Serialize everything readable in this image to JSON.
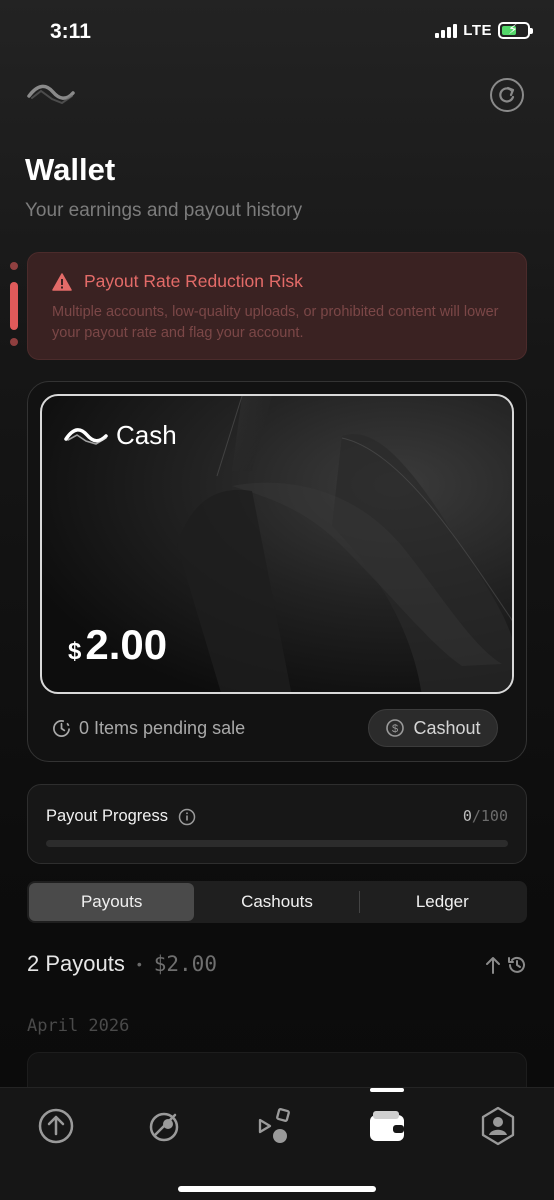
{
  "status_bar": {
    "time": "3:11",
    "network": "LTE"
  },
  "header": {
    "title": "Wallet",
    "subtitle": "Your earnings and payout history"
  },
  "warning": {
    "title": "Payout Rate Reduction Risk",
    "body": "Multiple accounts, low-quality uploads, or prohibited content will lower your payout rate and flag your account.",
    "color": "#e36b68"
  },
  "wallet_card": {
    "brand": "Cash",
    "currency_symbol": "$",
    "balance": "2.00",
    "pending_label": "0 Items pending sale",
    "cashout_label": "Cashout"
  },
  "payout_progress": {
    "label": "Payout Progress",
    "current": "0",
    "separator": "/",
    "total": "100",
    "fraction": 0
  },
  "tabs": [
    {
      "label": "Payouts",
      "active": true
    },
    {
      "label": "Cashouts",
      "active": false
    },
    {
      "label": "Ledger",
      "active": false
    }
  ],
  "summary": {
    "count_label": "2 Payouts",
    "dot": "•",
    "total": "$2.00"
  },
  "list": {
    "month": "April 2026"
  },
  "nav": {
    "items": [
      "upload-icon",
      "explore-icon",
      "shapes-icon",
      "wallet-icon",
      "profile-icon"
    ],
    "active_index": 3
  }
}
